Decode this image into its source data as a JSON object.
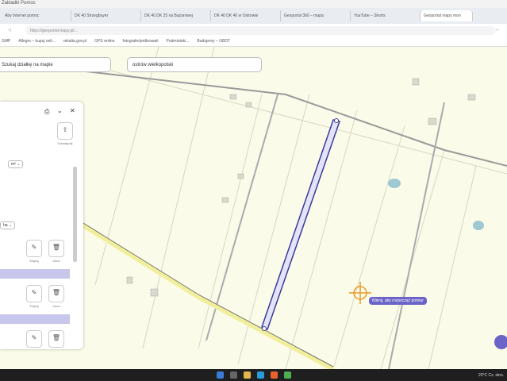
{
  "menubar": {
    "items": [
      "Zakładki",
      "Pomoc"
    ]
  },
  "tabs": [
    "Aby Internet pomoc",
    "DK 40 Strzegbuyer",
    "DK 40 DK 25 na Bazarowej",
    "DK 40 DK 40 w Ostrowie",
    "Geoportal 360 – mapa",
    "YouTube – Shorts",
    "Geoportal mapy mon"
  ],
  "address": {
    "url": "https://geoportal-mapy.pl/..."
  },
  "bookmarks": [
    "GMP",
    "Allegro – kupuj onli...",
    "rekalta.gov.pl",
    "GPS online",
    "fotografe/podkrowali",
    "Podmiotaki...",
    "Budujemy – GBDT"
  ],
  "search": {
    "parcel_placeholder": "Szukaj działkę na mapie",
    "location_value": "ostrów wielkopolski"
  },
  "panel": {
    "share_label": "Udostępnij",
    "unit": "m²",
    "unit2": "ha",
    "edit_label": "Edytuj",
    "delete_label": "Usuń"
  },
  "map": {
    "tooltip": "Kliknij, aby rozpocząć pomiar",
    "accent": "#3a3a9a"
  },
  "taskbar": {
    "weather": "20°C Cz. słon."
  }
}
